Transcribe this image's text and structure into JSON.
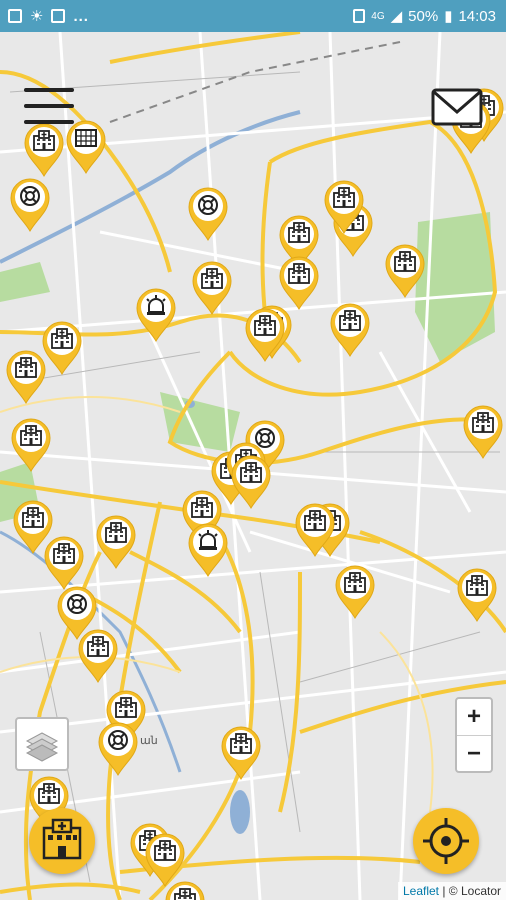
{
  "status_bar": {
    "dots": "...",
    "network": "4G",
    "battery": "50%",
    "time": "14:03"
  },
  "map": {
    "zoom_in": "+",
    "zoom_out": "−",
    "attribution_left": "Leaflet",
    "attribution_sep": " | © ",
    "attribution_right": "Locator",
    "place_label": "ան"
  },
  "markers": [
    {
      "type": "hospital"
    },
    {
      "type": "grid"
    },
    {
      "type": "lifebuoy"
    },
    {
      "type": "lifebuoy"
    },
    {
      "type": "hospital"
    },
    {
      "type": "hospital"
    },
    {
      "type": "hospital"
    },
    {
      "type": "hospital"
    },
    {
      "type": "hospital"
    },
    {
      "type": "hospital"
    },
    {
      "type": "alarm"
    },
    {
      "type": "hospital"
    },
    {
      "type": "hospital"
    },
    {
      "type": "hospital"
    },
    {
      "type": "hospital"
    },
    {
      "type": "hospital"
    },
    {
      "type": "hospital"
    },
    {
      "type": "hospital"
    },
    {
      "type": "hospital"
    },
    {
      "type": "lifebuoy"
    },
    {
      "type": "hospital"
    },
    {
      "type": "hospital"
    },
    {
      "type": "hospital"
    },
    {
      "type": "hospital"
    },
    {
      "type": "alarm"
    },
    {
      "type": "hospital"
    },
    {
      "type": "hospital"
    },
    {
      "type": "hospital"
    },
    {
      "type": "hospital"
    },
    {
      "type": "hospital"
    },
    {
      "type": "hospital"
    },
    {
      "type": "lifebuoy"
    },
    {
      "type": "hospital"
    },
    {
      "type": "hospital"
    },
    {
      "type": "hospital"
    },
    {
      "type": "lifebuoy"
    },
    {
      "type": "hospital"
    },
    {
      "type": "hospital"
    },
    {
      "type": "hospital"
    },
    {
      "type": "hospital"
    },
    {
      "type": "hospital"
    },
    {
      "type": "hospital"
    }
  ],
  "colors": {
    "marker": "#f5be28",
    "status_bar": "#4f9fbf",
    "road_major": "#f6c93a",
    "road_minor": "#ffffff",
    "water": "#8fb0d6",
    "park": "#b7dca0"
  }
}
